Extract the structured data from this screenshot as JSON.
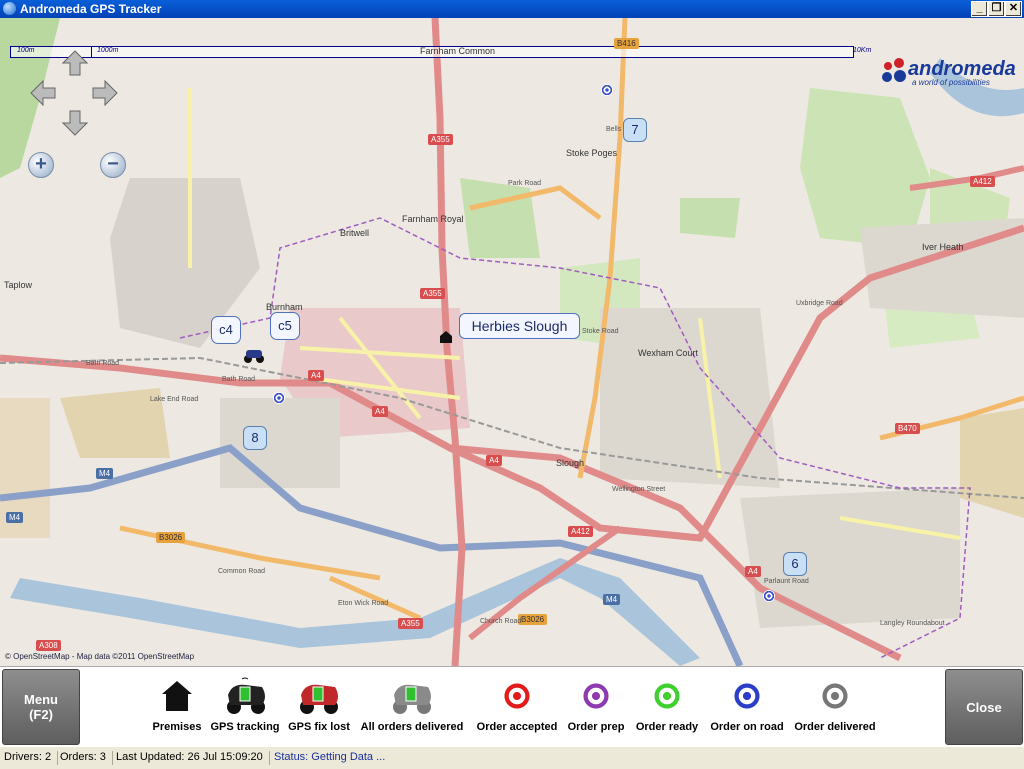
{
  "window": {
    "title": "Andromeda GPS Tracker",
    "controls": {
      "minimize": "_",
      "restore": "❐",
      "close": "✕"
    }
  },
  "map": {
    "scale_labels": [
      "100m",
      "1000m",
      "10Km"
    ],
    "logo": {
      "name": "andromeda",
      "tagline": "a world of possibilities"
    },
    "attribution": "© OpenStreetMap - Map data ©2011 OpenStreetMap",
    "places": [
      "Farnham Common",
      "Stoke Poges",
      "Farnham Royal",
      "Britwell",
      "Taplow",
      "Burnham",
      "Wexham Court",
      "Iver Heath",
      "Slough"
    ],
    "roads": [
      "B416",
      "A355",
      "A412",
      "A355",
      "A4",
      "A4",
      "A4",
      "M4",
      "M4",
      "B3026",
      "B3026",
      "A412",
      "A4",
      "M4",
      "B470",
      "A308",
      "A355"
    ],
    "streets": [
      "Park Road",
      "Bath Road",
      "Bath Road",
      "Stoke Road",
      "Uxbridge Road",
      "Wellington Street",
      "Common Road",
      "Eton Wick Road",
      "Lake End Road",
      "Bells Hill",
      "Church Road",
      "Parlaunt Road",
      "Langley Roundabout"
    ],
    "premises_label": "Herbies Slough",
    "drivers": [
      {
        "label": "c4"
      },
      {
        "label": "c5"
      }
    ],
    "orders": [
      {
        "label": "7"
      },
      {
        "label": "8"
      },
      {
        "label": "6"
      }
    ]
  },
  "toolbar": {
    "menu_label": "Menu",
    "menu_shortcut": "(F2)",
    "close_label": "Close",
    "legend": [
      {
        "key": "premises",
        "label": "Premises"
      },
      {
        "key": "gps_tracking",
        "label": "GPS tracking"
      },
      {
        "key": "gps_fix_lost",
        "label": "GPS fix lost"
      },
      {
        "key": "all_delivered",
        "label": "All orders delivered"
      },
      {
        "key": "order_accepted",
        "label": "Order accepted",
        "color": "#e21b1b"
      },
      {
        "key": "order_prep",
        "label": "Order prep",
        "color": "#8e3bb0"
      },
      {
        "key": "order_ready",
        "label": "Order ready",
        "color": "#3fcf2e"
      },
      {
        "key": "order_on_road",
        "label": "Order on road",
        "color": "#2c3ec8"
      },
      {
        "key": "order_delivered",
        "label": "Order delivered",
        "color": "#777777"
      }
    ]
  },
  "status": {
    "drivers": "Drivers: 2",
    "orders": "Orders: 3",
    "last_updated": "Last Updated: 26 Jul 15:09:20",
    "status_text": "Status: Getting Data ..."
  }
}
